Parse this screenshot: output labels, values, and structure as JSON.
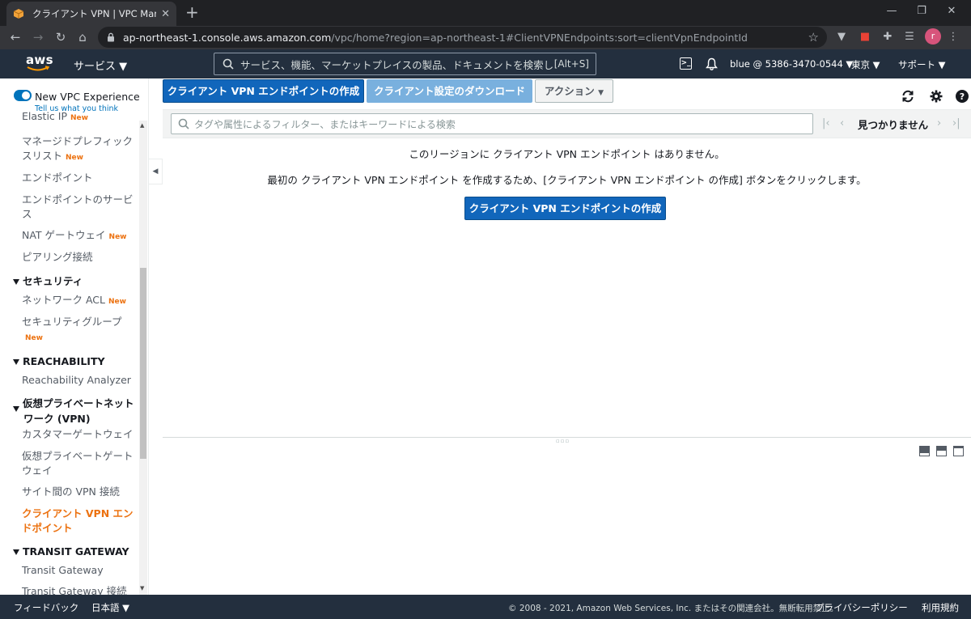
{
  "browser": {
    "tab_title": "クライアント VPN | VPC Manageme",
    "url_host": "ap-northeast-1.console.aws.amazon.com",
    "url_rest": "/vpc/home?region=ap-northeast-1#ClientVPNEndpoints:sort=clientVpnEndpointId",
    "profile_initial": "r"
  },
  "aws_nav": {
    "logo": "aws",
    "services_label": "サービス ▼",
    "search_placeholder": "サービス、機能、マーケットプレイスの製品、ドキュメントを検索し",
    "search_shortcut": "[Alt+S]",
    "account": "blue @ 5386-3470-0544 ▼",
    "region": "東京 ▼",
    "support": "サポート ▼"
  },
  "sidebar": {
    "new_experience_label": "New VPC Experience",
    "tell_us": "Tell us what you think",
    "partial_top_item": "Elastic IP",
    "items": [
      {
        "label": "マネージドプレフィックスリスト",
        "badge": "New"
      },
      {
        "label": "エンドポイント",
        "badge": ""
      },
      {
        "label": "エンドポイントのサービス",
        "badge": ""
      },
      {
        "label": "NAT ゲートウェイ",
        "badge": "New"
      },
      {
        "label": "ピアリング接続",
        "badge": ""
      }
    ],
    "security_header": "セキュリティ",
    "security_items": [
      {
        "label": "ネットワーク ACL",
        "badge": "New"
      },
      {
        "label": "セキュリティグループ",
        "badge": "New"
      }
    ],
    "reachability_header": "REACHABILITY",
    "reachability_items": [
      "Reachability Analyzer"
    ],
    "vpn_header": "仮想プライベートネットワーク (VPN)",
    "vpn_items": [
      "カスタマーゲートウェイ",
      "仮想プライベートゲートウェイ",
      "サイト間の VPN 接続",
      "クライアント VPN エンドポイント"
    ],
    "tgw_header": "TRANSIT GATEWAY",
    "tgw_items": [
      "Transit Gateway",
      "Transit Gateway 接続"
    ],
    "new_badge": "New"
  },
  "toolbar": {
    "create_label": "クライアント VPN エンドポイントの作成",
    "download_label": "クライアント設定のダウンロード",
    "actions_label": "アクション"
  },
  "filter": {
    "placeholder": "タグや属性によるフィルター、またはキーワードによる検索",
    "status": "見つかりません"
  },
  "empty_state": {
    "line1": "このリージョンに クライアント VPN エンドポイント はありません。",
    "line2": "最初の クライアント VPN エンドポイント を作成するため、[クライアント VPN エンドポイント の作成] ボタンをクリックします。",
    "button": "クライアント VPN エンドポイントの作成"
  },
  "footer": {
    "feedback": "フィードバック",
    "language": "日本語 ▼",
    "copyright": "© 2008 - 2021, Amazon Web Services, Inc. またはその関連会社。無断転用禁止。",
    "privacy": "プライバシーポリシー",
    "terms": "利用規約"
  },
  "colors": {
    "aws_nav_bg": "#232f3e",
    "primary_button": "#1166bb",
    "active_nav": "#ec7211",
    "new_badge": "#ec7211"
  }
}
